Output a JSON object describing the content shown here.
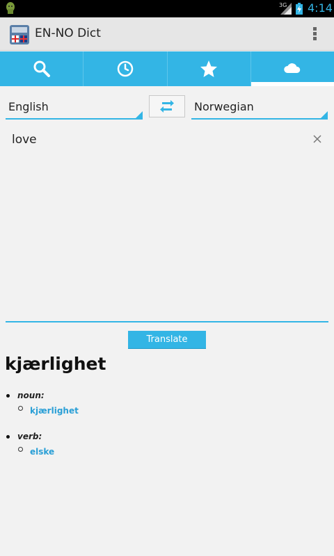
{
  "status_bar": {
    "network": "3G",
    "time": "4:14"
  },
  "app": {
    "title": "EN-NO Dict"
  },
  "tabs": [
    {
      "icon": "search-icon",
      "selected": false
    },
    {
      "icon": "clock-icon",
      "selected": false
    },
    {
      "icon": "star-icon",
      "selected": false
    },
    {
      "icon": "cloud-icon",
      "selected": true
    }
  ],
  "languages": {
    "from": "English",
    "to": "Norwegian"
  },
  "input": {
    "text": "love"
  },
  "translate_button": "Translate",
  "result": {
    "word": "kjærlighet",
    "entries": [
      {
        "pos": "noun:",
        "translations": [
          "kjærlighet"
        ]
      },
      {
        "pos": "verb:",
        "translations": [
          "elske"
        ]
      }
    ]
  },
  "colors": {
    "accent": "#33b5e5",
    "action_bar": "#e6e6e6",
    "background": "#f2f2f2",
    "link": "#2a9fd6"
  }
}
